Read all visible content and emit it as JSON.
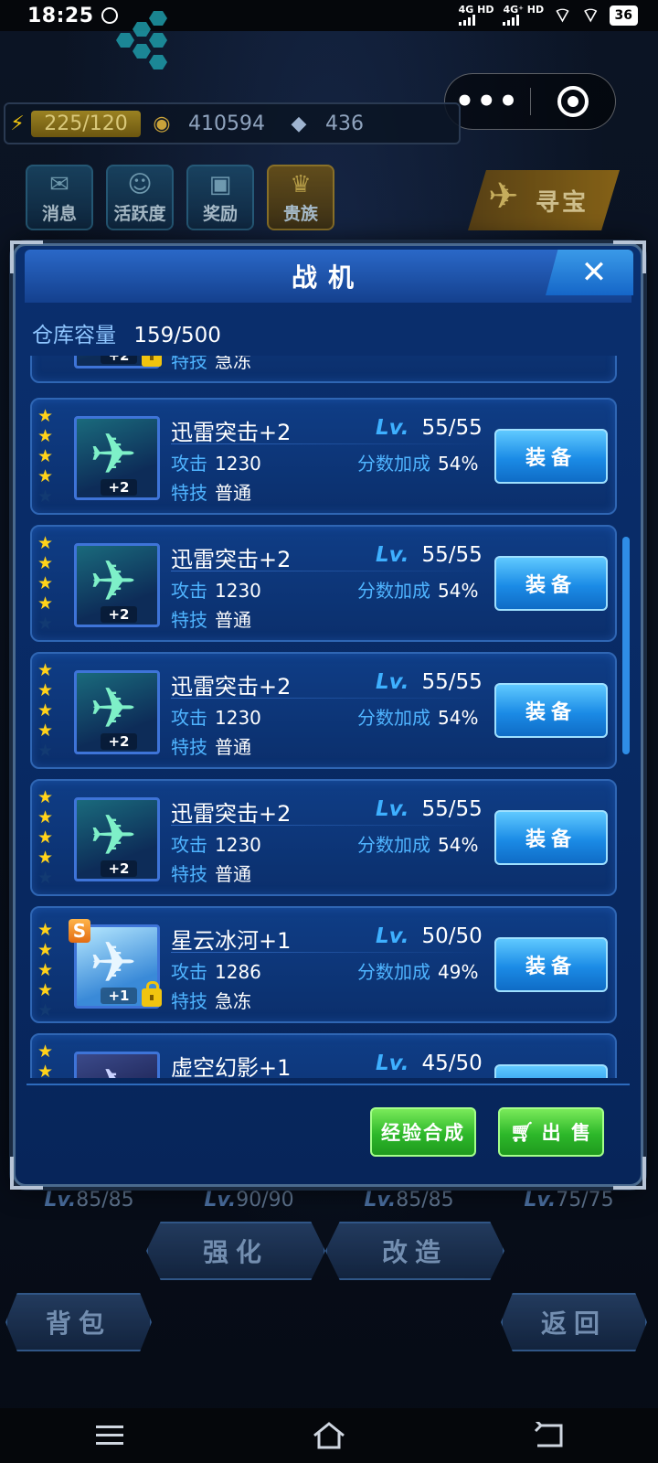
{
  "status": {
    "time": "18:25",
    "net1": "4G HD",
    "net2": "4G⁺ HD",
    "battery": "36"
  },
  "resources": {
    "energy": "225/120",
    "gold": "410594",
    "diamond": "436"
  },
  "top_menu": [
    {
      "label": "消息",
      "glyph": "✉"
    },
    {
      "label": "活跃度",
      "glyph": "☺"
    },
    {
      "label": "奖励",
      "glyph": "▣"
    },
    {
      "label": "贵族",
      "glyph": "♛"
    }
  ],
  "treasure": {
    "label": "寻宝"
  },
  "modal": {
    "title": "战机",
    "close_label": "✕",
    "capacity_label": "仓库容量",
    "capacity_value": "159/500",
    "attack_label": "攻击",
    "skill_label": "特技",
    "bonus_label": "分数加成",
    "lv_label": "Lv.",
    "equip_label": "装备",
    "partial_top": {
      "plus": "+2",
      "skill": "急冻"
    },
    "items": [
      {
        "name": "迅雷突击+2",
        "lv": "55/55",
        "attack": "1230",
        "bonus": "54%",
        "skill": "普通",
        "plus": "+2",
        "stars": 4
      },
      {
        "name": "迅雷突击+2",
        "lv": "55/55",
        "attack": "1230",
        "bonus": "54%",
        "skill": "普通",
        "plus": "+2",
        "stars": 4
      },
      {
        "name": "迅雷突击+2",
        "lv": "55/55",
        "attack": "1230",
        "bonus": "54%",
        "skill": "普通",
        "plus": "+2",
        "stars": 4
      },
      {
        "name": "迅雷突击+2",
        "lv": "55/55",
        "attack": "1230",
        "bonus": "54%",
        "skill": "普通",
        "plus": "+2",
        "stars": 4
      },
      {
        "name": "星云冰河+1",
        "lv": "50/50",
        "attack": "1286",
        "bonus": "49%",
        "skill": "急冻",
        "plus": "+1",
        "stars": 4,
        "rank": "S",
        "locked": true
      },
      {
        "name": "虚空幻影+1",
        "lv": "45/50",
        "stars": 2
      }
    ],
    "exp_merge_label": "经验合成",
    "sell_label": "出 售"
  },
  "background": {
    "levels": [
      {
        "lv": "Lv.",
        "value": "85/85"
      },
      {
        "lv": "Lv.",
        "value": "90/90"
      },
      {
        "lv": "Lv.",
        "value": "85/85"
      },
      {
        "lv": "Lv.",
        "value": "75/75"
      }
    ],
    "strengthen_label": "强化",
    "modify_label": "改造",
    "bag_label": "背包",
    "back_label": "返回"
  }
}
